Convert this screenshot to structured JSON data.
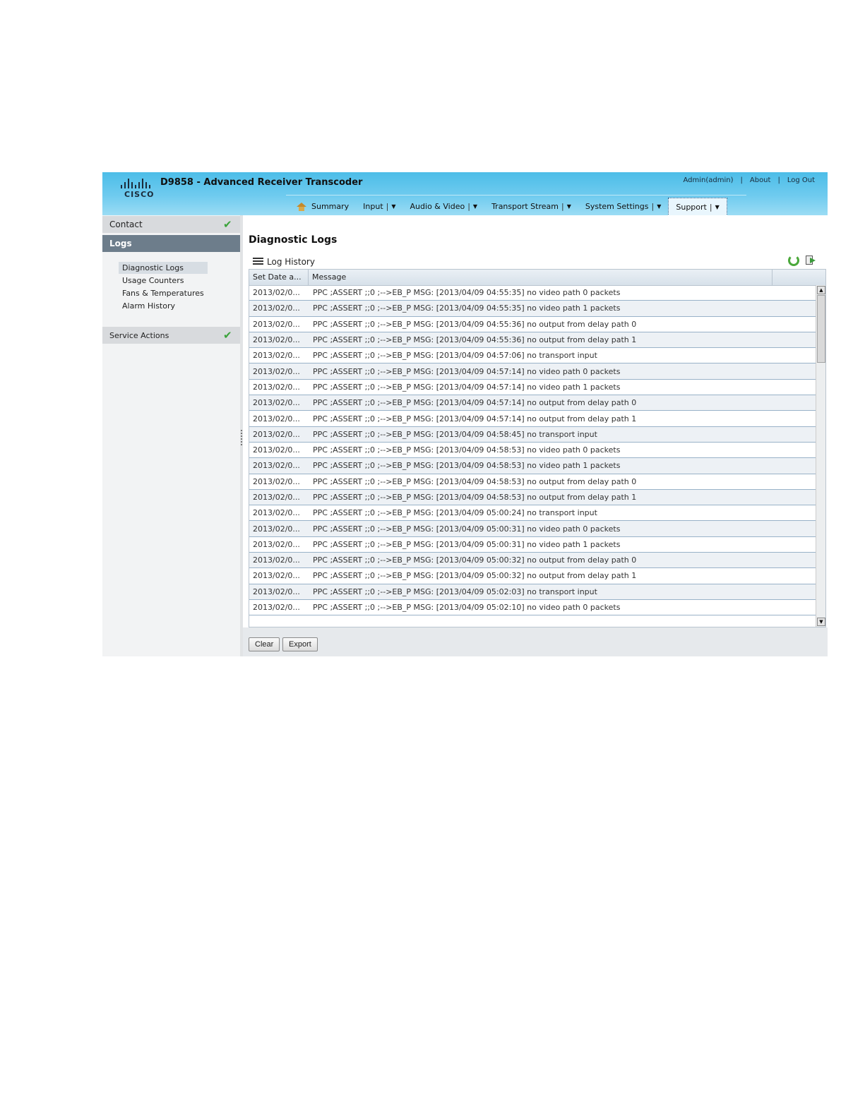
{
  "header": {
    "logo_text": "CISCO",
    "app_title": "D9858 - Advanced Receiver Transcoder",
    "links": {
      "user": "Admin(admin)",
      "about": "About",
      "logout": "Log Out",
      "separator": "|"
    }
  },
  "nav": {
    "items": [
      {
        "label": "Summary",
        "dropdown": false
      },
      {
        "label": "Input",
        "dropdown": true
      },
      {
        "label": "Audio & Video",
        "dropdown": true
      },
      {
        "label": "Transport Stream",
        "dropdown": true
      },
      {
        "label": "System Settings",
        "dropdown": true
      },
      {
        "label": "Support",
        "dropdown": true,
        "active": true
      }
    ],
    "pipe": "|",
    "caret": "▼"
  },
  "sidebar": {
    "contact": "Contact",
    "logs": "Logs",
    "sub_items": [
      "Diagnostic Logs",
      "Usage Counters",
      "Fans & Temperatures",
      "Alarm History"
    ],
    "service_actions": "Service Actions",
    "check": "✔"
  },
  "main": {
    "title": "Diagnostic Logs",
    "panel_title": "Log History",
    "columns": {
      "date": "Set Date a...",
      "message": "Message"
    },
    "rows": [
      {
        "date": "2013/02/0...",
        "message": "PPC ;ASSERT ;;0 ;-->EB_P MSG: [2013/04/09 04:55:35] no video path 0 packets"
      },
      {
        "date": "2013/02/0...",
        "message": "PPC ;ASSERT ;;0 ;-->EB_P MSG: [2013/04/09 04:55:35] no video path 1 packets"
      },
      {
        "date": "2013/02/0...",
        "message": "PPC ;ASSERT ;;0 ;-->EB_P MSG: [2013/04/09 04:55:36] no output from delay path 0"
      },
      {
        "date": "2013/02/0...",
        "message": "PPC ;ASSERT ;;0 ;-->EB_P MSG: [2013/04/09 04:55:36] no output from delay path 1"
      },
      {
        "date": "2013/02/0...",
        "message": "PPC ;ASSERT ;;0 ;-->EB_P MSG: [2013/04/09 04:57:06] no transport input"
      },
      {
        "date": "2013/02/0...",
        "message": "PPC ;ASSERT ;;0 ;-->EB_P MSG: [2013/04/09 04:57:14] no video path 0 packets"
      },
      {
        "date": "2013/02/0...",
        "message": "PPC ;ASSERT ;;0 ;-->EB_P MSG: [2013/04/09 04:57:14] no video path 1 packets"
      },
      {
        "date": "2013/02/0...",
        "message": "PPC ;ASSERT ;;0 ;-->EB_P MSG: [2013/04/09 04:57:14] no output from delay path 0"
      },
      {
        "date": "2013/02/0...",
        "message": "PPC ;ASSERT ;;0 ;-->EB_P MSG: [2013/04/09 04:57:14] no output from delay path 1"
      },
      {
        "date": "2013/02/0...",
        "message": "PPC ;ASSERT ;;0 ;-->EB_P MSG: [2013/04/09 04:58:45] no transport input"
      },
      {
        "date": "2013/02/0...",
        "message": "PPC ;ASSERT ;;0 ;-->EB_P MSG: [2013/04/09 04:58:53] no video path 0 packets"
      },
      {
        "date": "2013/02/0...",
        "message": "PPC ;ASSERT ;;0 ;-->EB_P MSG: [2013/04/09 04:58:53] no video path 1 packets"
      },
      {
        "date": "2013/02/0...",
        "message": "PPC ;ASSERT ;;0 ;-->EB_P MSG: [2013/04/09 04:58:53] no output from delay path 0"
      },
      {
        "date": "2013/02/0...",
        "message": "PPC ;ASSERT ;;0 ;-->EB_P MSG: [2013/04/09 04:58:53] no output from delay path 1"
      },
      {
        "date": "2013/02/0...",
        "message": "PPC ;ASSERT ;;0 ;-->EB_P MSG: [2013/04/09 05:00:24] no transport input"
      },
      {
        "date": "2013/02/0...",
        "message": "PPC ;ASSERT ;;0 ;-->EB_P MSG: [2013/04/09 05:00:31] no video path 0 packets"
      },
      {
        "date": "2013/02/0...",
        "message": "PPC ;ASSERT ;;0 ;-->EB_P MSG: [2013/04/09 05:00:31] no video path 1 packets"
      },
      {
        "date": "2013/02/0...",
        "message": "PPC ;ASSERT ;;0 ;-->EB_P MSG: [2013/04/09 05:00:32] no output from delay path 0"
      },
      {
        "date": "2013/02/0...",
        "message": "PPC ;ASSERT ;;0 ;-->EB_P MSG: [2013/04/09 05:00:32] no output from delay path 1"
      },
      {
        "date": "2013/02/0...",
        "message": "PPC ;ASSERT ;;0 ;-->EB_P MSG: [2013/04/09 05:02:03] no transport input"
      },
      {
        "date": "2013/02/0...",
        "message": "PPC ;ASSERT ;;0 ;-->EB_P MSG: [2013/04/09 05:02:10] no video path 0 packets"
      }
    ],
    "scroll": {
      "up": "▲",
      "down": "▼"
    }
  },
  "footer": {
    "clear_label": "Clear",
    "export_label": "Export"
  },
  "icons": {
    "home": "home-icon",
    "check": "check-icon",
    "menu": "menu-icon",
    "refresh": "refresh-icon",
    "export": "export-icon"
  },
  "colors": {
    "header": "#4cbde8",
    "active_section": "#6d7d8b",
    "check": "#3aa33a",
    "row_border": "#99b2c8"
  }
}
